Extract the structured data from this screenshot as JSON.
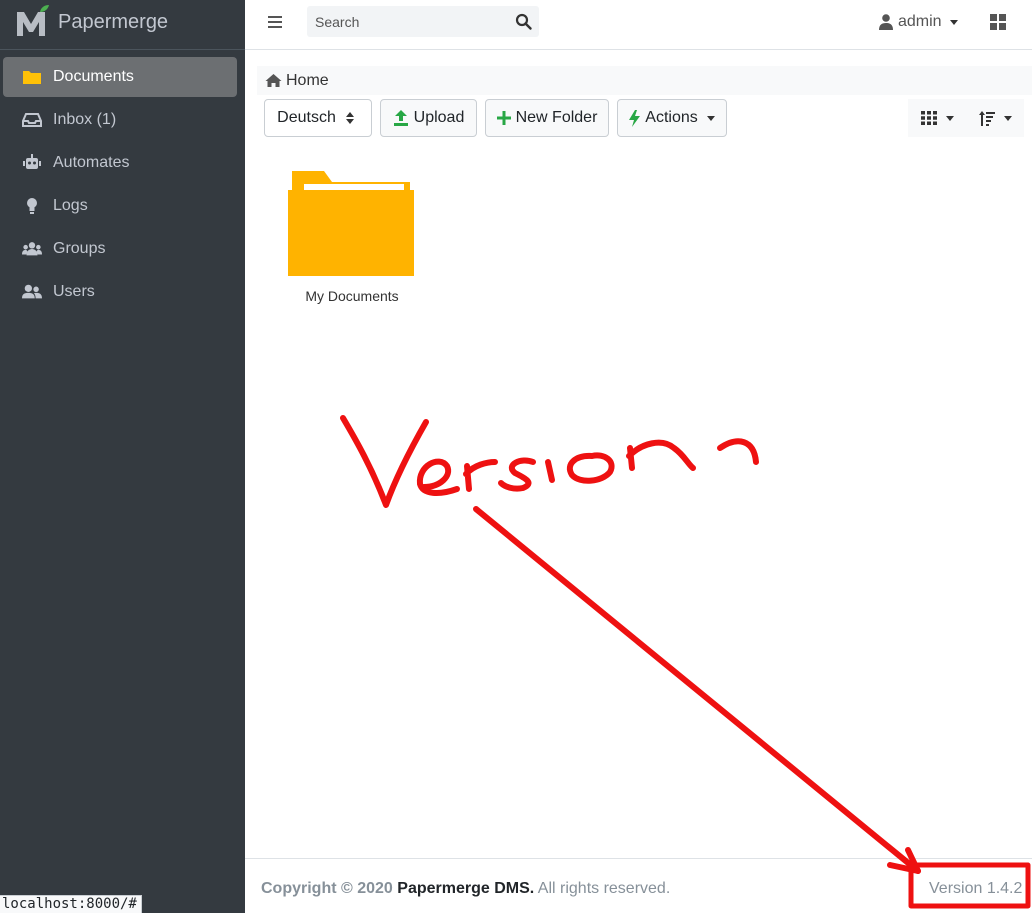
{
  "app": {
    "name": "Papermerge"
  },
  "colors": {
    "sidebar_bg": "#343a40",
    "folder": "#ffb300",
    "annotation": "#ee1111",
    "accent_green": "#28a745"
  },
  "sidebar": {
    "items": [
      {
        "label": "Documents",
        "icon": "folder-icon",
        "active": true
      },
      {
        "label": "Inbox (1)",
        "icon": "inbox-icon",
        "active": false
      },
      {
        "label": "Automates",
        "icon": "robot-icon",
        "active": false
      },
      {
        "label": "Logs",
        "icon": "lightbulb-icon",
        "active": false
      },
      {
        "label": "Groups",
        "icon": "users-group-icon",
        "active": false
      },
      {
        "label": "Users",
        "icon": "user-friends-icon",
        "active": false
      }
    ]
  },
  "topbar": {
    "search_placeholder": "Search",
    "user": "admin"
  },
  "breadcrumb": {
    "home": "Home"
  },
  "toolbar": {
    "language": "Deutsch",
    "upload": "Upload",
    "new_folder": "New Folder",
    "actions": "Actions"
  },
  "content": {
    "folders": [
      {
        "name": "My Documents"
      }
    ]
  },
  "annotation": {
    "text": "Version"
  },
  "footer": {
    "copyright_prefix": "Copyright © 2020",
    "copyright_brand": "Papermerge DMS.",
    "copyright_suffix": "All rights reserved.",
    "version": "Version 1.4.2"
  },
  "statusbar": {
    "url": "localhost:8000/#"
  }
}
